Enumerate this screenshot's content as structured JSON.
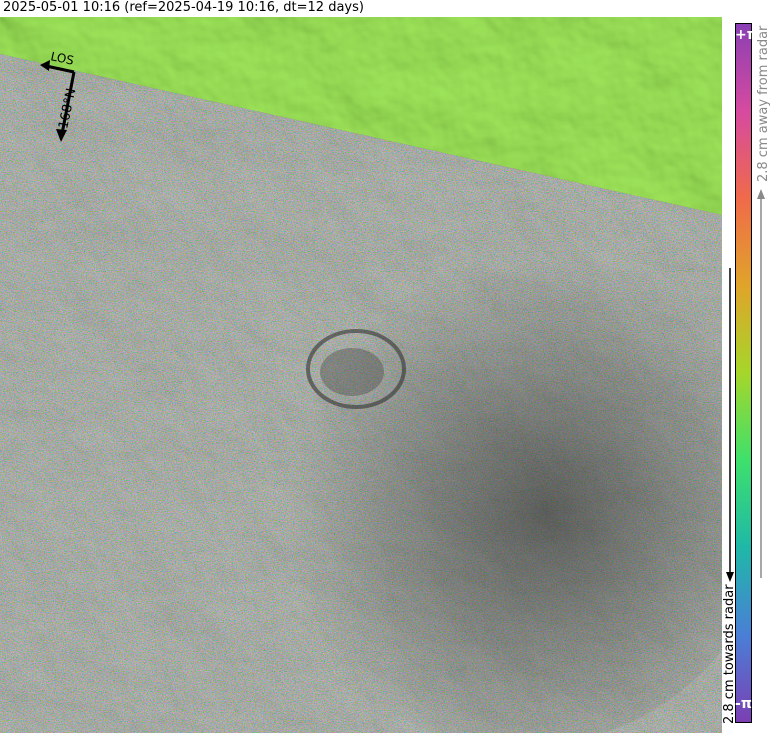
{
  "title": "2025-05-01 10:16 (ref=2025-04-19 10:16, dt=12 days)",
  "compass": {
    "los_label": "LOS",
    "heading_label": "-168°N"
  },
  "colorbar": {
    "top_label": "+π",
    "bottom_label": "-π",
    "away_label": "2.8 cm away from radar",
    "towards_label": "2.8 cm towards radar",
    "colors": [
      "#7b3fb4",
      "#4a7fd6",
      "#1fb8a8",
      "#3ee06c",
      "#a6d62a",
      "#e0a42a",
      "#f06a4a",
      "#d64aa0",
      "#8a3fb4"
    ]
  },
  "map": {
    "no_data_color": "#7ed63a",
    "terrain_color": "#5a5a5a"
  }
}
